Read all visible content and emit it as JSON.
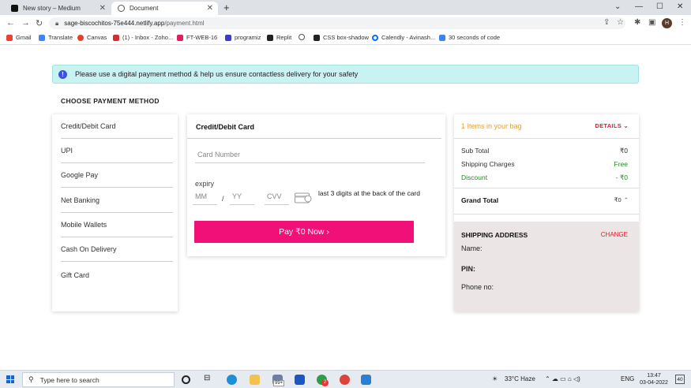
{
  "browser": {
    "tabs": [
      {
        "title": "New story – Medium",
        "active": false
      },
      {
        "title": "Document",
        "active": true
      }
    ],
    "url_host": "sage-biscochitos-75e444.netlify.app",
    "url_path": "/payment.html",
    "avatar_letter": "H",
    "bookmarks": [
      {
        "label": "Gmail",
        "icon": "gmail-icon",
        "color": "#ea4335"
      },
      {
        "label": "Translate",
        "icon": "translate-icon",
        "color": "#4285f4"
      },
      {
        "label": "Canvas",
        "icon": "canvas-icon",
        "color": "#e13f2b"
      },
      {
        "label": "(1) - Inbox - Zoho...",
        "icon": "zoho-icon",
        "color": "#d32f2f"
      },
      {
        "label": "FT-WEB-16",
        "icon": "slack-icon",
        "color": "#e01e5a"
      },
      {
        "label": "programiz",
        "icon": "programiz-icon",
        "color": "#3b3bd1"
      },
      {
        "label": "Replit",
        "icon": "replit-icon",
        "color": "#222222"
      },
      {
        "label": "",
        "icon": "history-icon",
        "color": "#555555"
      },
      {
        "label": "CSS box-shadow",
        "icon": "css-icon",
        "color": "#222222"
      },
      {
        "label": "Calendly - Avinash...",
        "icon": "calendly-icon",
        "color": "#006bff"
      },
      {
        "label": "30 seconds of code",
        "icon": "code-icon",
        "color": "#3b82f6"
      }
    ]
  },
  "notice": {
    "icon": "info-icon",
    "text": "Please use a digital payment method & help us ensure contactless delivery for your safety"
  },
  "section_title": "CHOOSE PAYMENT METHOD",
  "methods": [
    "Credit/Debit Card",
    "UPI",
    "Google Pay",
    "Net Banking",
    "Mobile Wallets",
    "Cash On Delivery",
    "Gift Card"
  ],
  "card_form": {
    "title": "Credit/Debit Card",
    "card_number_placeholder": "Card Number",
    "expiry_label": "expiry",
    "mm_placeholder": "MM",
    "slash": "/",
    "yy_placeholder": "YY",
    "cvv_placeholder": "CVV",
    "cvv_hint": "last 3 digits at the back of the card",
    "pay_button": "Pay ₹0 Now ›"
  },
  "summary": {
    "bag_text": "1 Items in your bag",
    "details_label": "DETAILS",
    "rows": [
      {
        "label": "Sub Total",
        "value": "₹0",
        "color": "#333333"
      },
      {
        "label": "Shipping Charges",
        "value": "Free",
        "color": "#1a8f1a"
      },
      {
        "label": "Discount",
        "value": "- ₹0",
        "color": "#1a8f1a"
      }
    ],
    "grand_total_label": "Grand Total",
    "grand_total_value": "₹0",
    "shipping": {
      "title": "SHIPPING ADDRESS",
      "change_label": "CHANGE",
      "name_label": "Name:",
      "pin_label": "PIN:",
      "phone_label": "Phone no:"
    }
  },
  "colors": {
    "accent_pink": "#f10f78",
    "notice_bg": "#c9f3f2",
    "link_red": "#e21b2d",
    "bag_orange": "#e0a13a"
  },
  "taskbar": {
    "search_placeholder": "Type here to search",
    "badge_mail": "99+",
    "badge_chrome": "2",
    "weather": "33°C  Haze",
    "lang": "ENG",
    "time": "13:47",
    "date": "03-04-2022",
    "notifications": "40"
  }
}
